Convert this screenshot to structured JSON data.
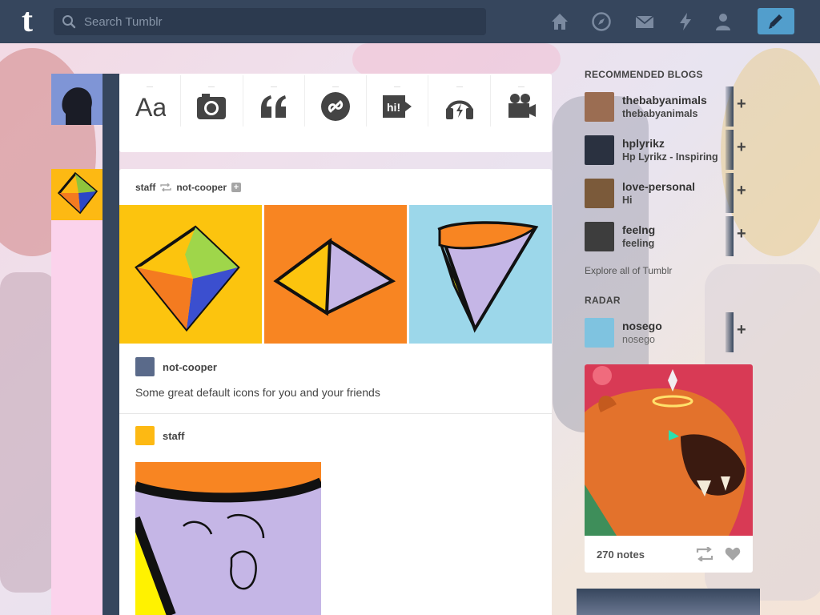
{
  "header": {
    "logo": "t",
    "search_placeholder": "Search Tumblr",
    "nav_icons": [
      "home-icon",
      "compass-icon",
      "mail-icon",
      "lightning-icon",
      "account-icon"
    ],
    "compose_icon": "pencil-icon"
  },
  "post_form": {
    "items": [
      "text-icon",
      "photo-icon",
      "quote-icon",
      "link-icon",
      "chat-icon",
      "audio-icon",
      "video-icon"
    ],
    "text_glyph": "Aa",
    "chat_glyph": "hi!"
  },
  "post": {
    "blog": "staff",
    "reblogged_from": "not-cooper",
    "follow_glyph": "+",
    "reblog": {
      "blog": "not-cooper",
      "body": "Some great default icons for you and your friends"
    },
    "source": {
      "blog": "staff"
    }
  },
  "sidebar": {
    "recommended_title": "RECOMMENDED BLOGS",
    "blogs": [
      {
        "name": "thebabyanimals",
        "sub": "thebabyanimals",
        "color": "#9b6d52"
      },
      {
        "name": "hplyrikz",
        "sub": "Hp Lyrikz - Inspiring",
        "color": "#2a3140"
      },
      {
        "name": "love-personal",
        "sub": "Hi",
        "color": "#7b5a3a"
      },
      {
        "name": "feelng",
        "sub": "feeling",
        "color": "#3d3d3d"
      }
    ],
    "follow_glyph": "+",
    "explore": "Explore all of Tumblr",
    "radar_title": "RADAR",
    "radar": {
      "name": "nosego",
      "sub": "nosego",
      "notes": "270 notes",
      "color": "#7fc3e0"
    }
  },
  "colors": {
    "nav_bg": "#36465d",
    "accent": "#529ecc",
    "staff_yellow": "#fdb913",
    "pink_strip": "#fbd3ec"
  }
}
